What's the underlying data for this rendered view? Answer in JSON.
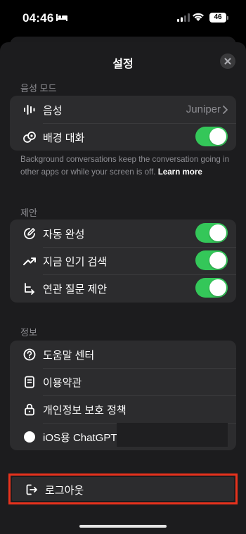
{
  "status_bar": {
    "time": "04:46",
    "battery": "46"
  },
  "sheet": {
    "title": "설정"
  },
  "voice_mode": {
    "section_label": "음성 모드",
    "voice_label": "음성",
    "voice_value": "Juniper",
    "background_label": "배경 대화",
    "background_on": true,
    "footnote": "Background conversations keep the conversation going in other apps or while your screen is off.",
    "footnote_link": "Learn more"
  },
  "suggestions": {
    "section_label": "제안",
    "items": [
      {
        "label": "자동 완성",
        "on": true
      },
      {
        "label": "지금 인기 검색",
        "on": true
      },
      {
        "label": "연관 질문 제안",
        "on": true
      }
    ]
  },
  "info": {
    "section_label": "정보",
    "help": "도움말 센터",
    "terms": "이용약관",
    "privacy": "개인정보 보호 정책",
    "app_version": "iOS용 ChatGPT"
  },
  "logout_label": "로그아웃",
  "colors": {
    "toggle_on": "#34c759",
    "highlight": "#e8321d",
    "background": "#1c1c1e",
    "group": "#2c2c2e"
  }
}
